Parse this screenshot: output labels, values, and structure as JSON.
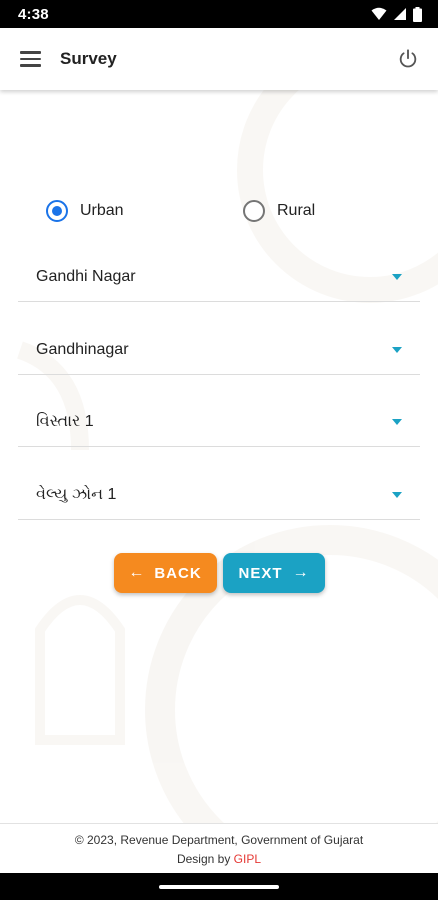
{
  "status_bar": {
    "time": "4:38",
    "icons": [
      "wifi-icon",
      "signal-icon",
      "battery-icon"
    ]
  },
  "app_bar": {
    "title": "Survey",
    "menu_icon": "hamburger-menu-icon",
    "logout_icon": "power-icon"
  },
  "form": {
    "area_type": {
      "options": [
        {
          "label": "Urban",
          "selected": true
        },
        {
          "label": "Rural",
          "selected": false
        }
      ]
    },
    "dropdowns": [
      {
        "value": "Gandhi Nagar"
      },
      {
        "value": "Gandhinagar"
      },
      {
        "value": "વિસ્તાર 1"
      },
      {
        "value": "વેલ્યુ ઝોન 1"
      }
    ]
  },
  "buttons": {
    "back_label": "BACK",
    "back_arrow": "←",
    "next_label": "NEXT",
    "next_arrow": "→"
  },
  "footer": {
    "copyright": "© 2023, Revenue Department, Government of Gujarat",
    "design_prefix": "Design by",
    "design_company": "GIPL"
  },
  "colors": {
    "radio_selected": "#1a73e8",
    "caret": "#1ba2c4",
    "back_button": "#f58a1f",
    "next_button": "#1ba2c4",
    "brand_link": "#e53935"
  }
}
